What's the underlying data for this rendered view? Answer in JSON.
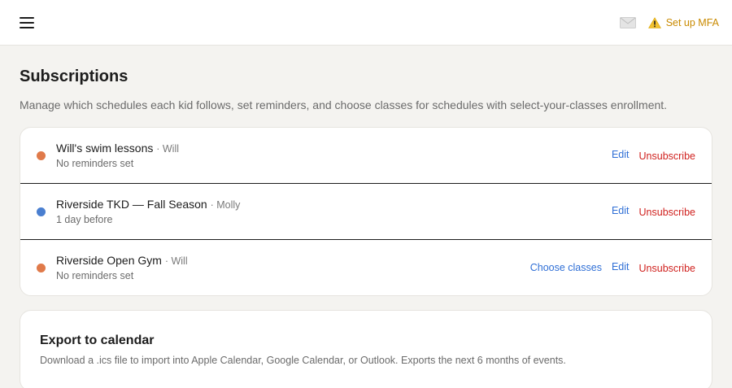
{
  "header": {
    "mfa_label": "Set up MFA"
  },
  "page": {
    "title": "Subscriptions",
    "description": "Manage which schedules each kid follows, set reminders, and choose classes for schedules with select-your-classes enrollment."
  },
  "subscriptions": [
    {
      "name": "Will's swim lessons",
      "kid": "· Will",
      "reminder": "No reminders set",
      "color": "#e07a4a",
      "choose_label": "",
      "edit_label": "Edit",
      "unsubscribe_label": "Unsubscribe"
    },
    {
      "name": "Riverside TKD — Fall Season",
      "kid": "· Molly",
      "reminder": "1 day before",
      "color": "#4a7fd0",
      "choose_label": "",
      "edit_label": "Edit",
      "unsubscribe_label": "Unsubscribe"
    },
    {
      "name": "Riverside Open Gym",
      "kid": "· Will",
      "reminder": "No reminders set",
      "color": "#e07a4a",
      "choose_label": "Choose classes",
      "edit_label": "Edit",
      "unsubscribe_label": "Unsubscribe"
    }
  ],
  "export": {
    "title": "Export to calendar",
    "description": "Download a .ics file to import into Apple Calendar, Google Calendar, or Outlook. Exports the next 6 months of events."
  },
  "colors": {
    "accent_link": "#2f6fd6",
    "danger": "#d0221f",
    "warning": "#c98a00"
  },
  "icons": [
    "menu-icon",
    "mail-icon",
    "warning-icon"
  ]
}
